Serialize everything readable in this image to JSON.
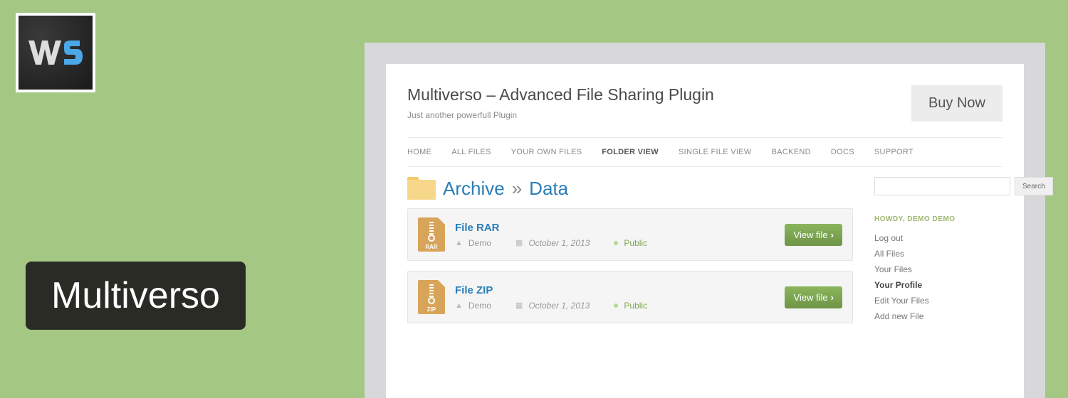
{
  "badge": {
    "title": "Multiverso"
  },
  "header": {
    "title": "Multiverso – Advanced File Sharing Plugin",
    "subtitle": "Just another powerfull Plugin",
    "buy_label": "Buy Now"
  },
  "nav": {
    "items": [
      {
        "label": "HOME"
      },
      {
        "label": "ALL FILES"
      },
      {
        "label": "YOUR OWN FILES"
      },
      {
        "label": "FOLDER VIEW",
        "active": true
      },
      {
        "label": "SINGLE FILE VIEW"
      },
      {
        "label": "BACKEND"
      },
      {
        "label": "DOCS"
      },
      {
        "label": "SUPPORT"
      }
    ]
  },
  "breadcrumb": {
    "root": "Archive",
    "sep": "»",
    "current": "Data"
  },
  "files": [
    {
      "name": "File RAR",
      "ext": "RAR",
      "author": "Demo",
      "date": "October 1, 2013",
      "visibility": "Public",
      "view_label": "View file"
    },
    {
      "name": "File ZIP",
      "ext": "ZIP",
      "author": "Demo",
      "date": "October 1, 2013",
      "visibility": "Public",
      "view_label": "View file"
    }
  ],
  "sidebar": {
    "search_label": "Search",
    "howdy": "HOWDY, DEMO DEMO",
    "links": [
      {
        "label": "Log out"
      },
      {
        "label": "All Files"
      },
      {
        "label": "Your Files"
      },
      {
        "label": "Your Profile",
        "active": true
      },
      {
        "label": "Edit Your Files"
      },
      {
        "label": "Add new File"
      }
    ]
  }
}
